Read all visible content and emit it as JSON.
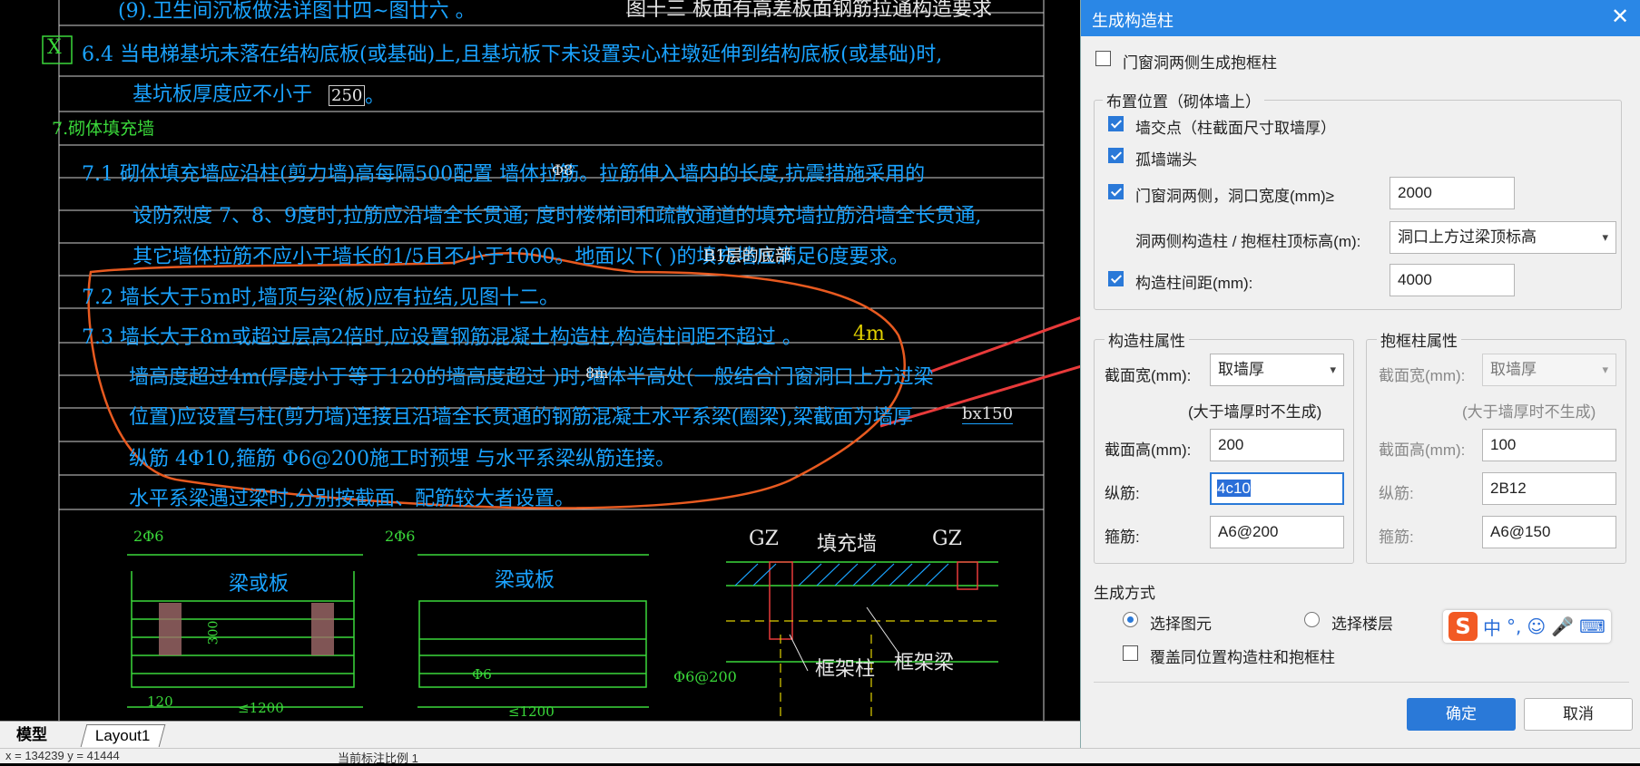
{
  "cad": {
    "lines": [
      "(9).卫生间沉板做法详图廿四~图廿六 。",
      "6.4  当电梯基坑未落在结构底板(或基础)上,且基坑板下未设置实心柱墩延伸到结构底板(或基础)时,",
      "基坑板厚度应不小于",
      "250",
      "。",
      "7.砌体填充墙",
      "7.1  砌体填充墙应沿柱(剪力墙)高每隔500配置     墙体拉筋。拉筋伸入墙内的长度,抗震措施采用的",
      "设防烈度   7、8、9度时,拉筋应沿墙全长贯通;  度时楼梯间和疏散通道的填充墙拉筋沿墙全长贯通,",
      "其它墙体拉筋不应小于墙长的1/5且不小于1000。地面以下(          )的填充墙应满足6度要求。",
      "7.2  墙长大于5m时,墙顶与梁(板)应有拉结,见图十二。",
      "7.3  墙长大于8m或超过层高2倍时,应设置钢筋混凝土构造柱,构造柱间距不超过      。",
      "墙高度超过4m(厚度小于等于120的墙高度超过     )时,墙体半高处(一般结合门窗洞口上方过梁",
      "位置)应设置与柱(剪力墙)连接且沿墙全长贯通的钢筋混凝土水平系梁(圈梁),梁截面为墙厚",
      "纵筋  4Φ10,箍筋    Φ6@200施工时预埋       与水平系梁纵筋连接。",
      "水平系梁遇过梁时,分别按截面、配筋较大者设置。"
    ],
    "marks": {
      "x_box": "X",
      "top_right": "图十三 板面有高差板面钢筋拉通构造要求",
      "yellow_4m": "4m",
      "bx150": "bx150",
      "mark_2d6": "2Φ6",
      "mark_2d6_b": "2Φ6",
      "liangchengban_1": "梁或板",
      "liangchengban_2": "梁或板",
      "gz_1": "GZ",
      "gz_2": "GZ",
      "tianchongqiang": "填充墙",
      "kuangjiazhu": "框架柱",
      "kuangjialiang": "框架梁",
      "d6_200": "Φ6@200",
      "dim_1200_a": "≤1200",
      "dim_1200_b": "≤1200",
      "dim_300": "300",
      "dim_120": "120",
      "floor_mark": "B1层的底部",
      "m_mark": "8m",
      "d8": "Φ8",
      "d6": "Φ6"
    }
  },
  "tabs": [
    "模型",
    "Layout1"
  ],
  "status": {
    "coords": "x = 134239  y = 41444",
    "scale": "当前标注比例   1"
  },
  "dialog": {
    "title": "生成构造柱",
    "door_window_frame_label": "门窗洞两侧生成抱框柱",
    "placement_group": "布置位置（砌体墙上）",
    "wall_intersection": "墙交点（柱截面尺寸取墙厚）",
    "isolated_wall_end": "孤墙端头",
    "opening_sides": "门窗洞两侧，洞口宽度(mm)≥",
    "opening_width": "2000",
    "top_elevation_label": "洞两侧构造柱 / 抱框柱顶标高(m):",
    "top_elevation_value": "洞口上方过梁顶标高",
    "spacing_label": "构造柱间距(mm):",
    "spacing_value": "4000",
    "gz_group": "构造柱属性",
    "bk_group": "抱框柱属性",
    "width_label": "截面宽(mm):",
    "gz_width": "取墙厚",
    "bk_width": "取墙厚",
    "no_generate_note": "(大于墙厚时不生成)",
    "height_label": "截面高(mm):",
    "gz_height": "200",
    "bk_height": "100",
    "long_bar_label": "纵筋:",
    "gz_long_bar": "4c10",
    "bk_long_bar": "2B12",
    "stirrup_label": "箍筋:",
    "gz_stirrup": "A6@200",
    "bk_stirrup": "A6@150",
    "gen_mode_label": "生成方式",
    "select_element": "选择图元",
    "select_floor": "选择楼层",
    "overwrite_label": "覆盖同位置构造柱和抱框柱",
    "ok": "确定",
    "cancel": "取消"
  },
  "ime": {
    "logo": "S",
    "lang": "中",
    "punct": "°,",
    "emoji": "☺",
    "mic": "🎤",
    "kbd": "⌨"
  },
  "colors": {
    "title_bar": "#2a87e6",
    "accent": "#2a79d8",
    "cad_text": "#1aa3ff",
    "annotation": "#e85a20",
    "arrow": "#e83a3a"
  }
}
